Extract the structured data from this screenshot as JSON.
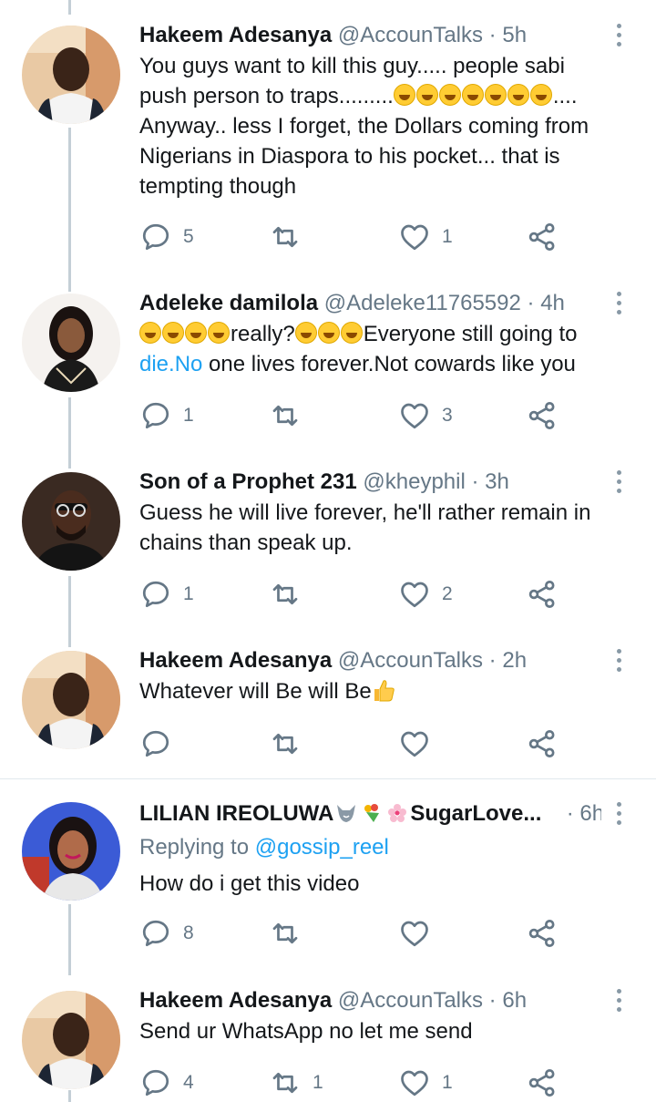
{
  "tweets": [
    {
      "name": "Hakeem Adesanya",
      "handle": "@AccounTalks",
      "sep": "·",
      "time": "5h",
      "line1": "You guys want to kill this guy..... people sabi",
      "line2_pre": "push person to traps.........",
      "line2_post": "....",
      "line3": "Anyway.. less I forget, the Dollars coming from",
      "line4": "Nigerians in Diaspora to his pocket... that is",
      "line5": "tempting though",
      "replies": "5",
      "retweets": "",
      "likes": "1"
    },
    {
      "name": "Adeleke damilola",
      "handle": "@Adeleke11765592",
      "sep": "·",
      "time": "4h",
      "line1_a": "really?",
      "line1_b": "Everyone still going to",
      "link": "die.No",
      "line2": " one lives forever.Not cowards like you",
      "replies": "1",
      "retweets": "",
      "likes": "3"
    },
    {
      "name": "Son of a Prophet 231",
      "handle": "@kheyphil",
      "sep": "·",
      "time": "3h",
      "line1": "Guess he will live forever, he'll rather remain in",
      "line2": "chains than speak up.",
      "replies": "1",
      "retweets": "",
      "likes": "2"
    },
    {
      "name": "Hakeem Adesanya",
      "handle": "@AccounTalks",
      "sep": "·",
      "time": "2h",
      "line1": "Whatever will Be will Be",
      "replies": "",
      "retweets": "",
      "likes": ""
    },
    {
      "name": "LILIAN IREOLUWA",
      "name_suffix": "SugarLove...",
      "sep": "·",
      "time": "6h",
      "replying_label": "Replying to",
      "replying_handle": "@gossip_reel",
      "line1": "How do i get this video",
      "replies": "8",
      "retweets": "",
      "likes": ""
    },
    {
      "name": "Hakeem Adesanya",
      "handle": "@AccounTalks",
      "sep": "·",
      "time": "6h",
      "line1": "Send ur WhatsApp no let me send",
      "replies": "4",
      "retweets": "1",
      "likes": "1"
    }
  ],
  "icons": {
    "reply": "reply-icon",
    "retweet": "retweet-icon",
    "like": "heart-icon",
    "share": "share-icon",
    "more": "more-vertical-icon"
  },
  "colors": {
    "link": "#1da1f2",
    "secondary_text": "#657786",
    "thread_line": "#c4cfd6"
  }
}
